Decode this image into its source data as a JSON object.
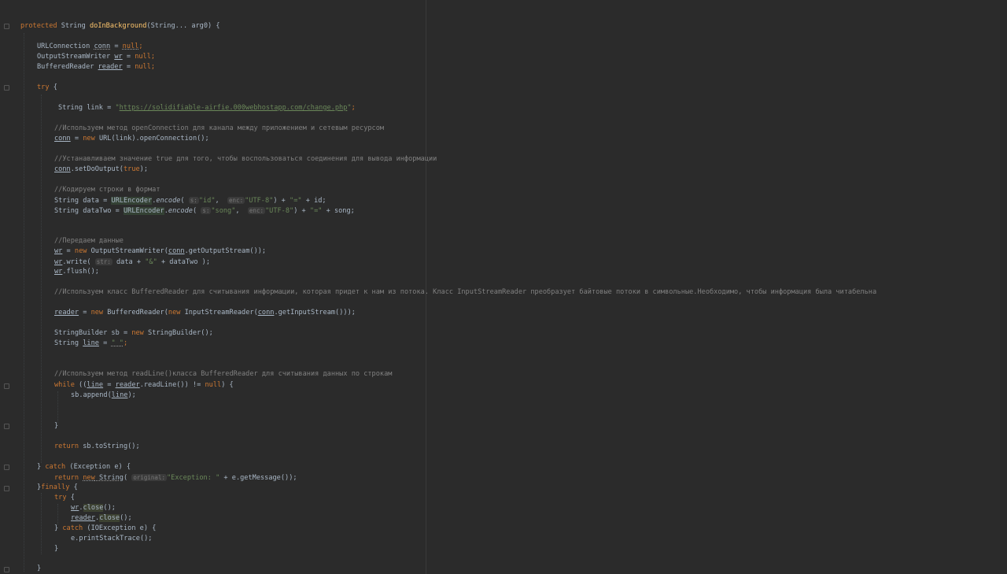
{
  "editor": {
    "lines": {
      "method_sig": {
        "kw_protected": "protected",
        "type": " String ",
        "method_name": "doInBackground",
        "params": "(String... arg0) {"
      },
      "decl_conn": {
        "type": "URLConnection ",
        "var": "conn",
        "eq": " = ",
        "val": "null",
        "semi": ";"
      },
      "decl_wr": {
        "type": "OutputStreamWriter ",
        "var": "wr",
        "eq": " = ",
        "val": "null",
        "semi": ";"
      },
      "decl_reader": {
        "type": "BufferedReader ",
        "var": "reader",
        "eq": " = ",
        "val": "null",
        "semi": ";"
      },
      "try_open": {
        "kw": "try",
        "brace": " {"
      },
      "link_decl": {
        "prefix": "String link = ",
        "q1": "\"",
        "url": "https://solidifiable-airfie.000webhostapp.com/change.php",
        "q2": "\"",
        "semi": ";"
      },
      "comment_open_connection": "//Используем метод openConnection для канала между приложением и сетевым ресурсом",
      "open_conn": {
        "var": "conn",
        "eq": " = ",
        "kw_new": "new",
        "rest": " URL(link).openConnection();"
      },
      "comment_set_do_output": "//Устанавливаем значение true для того, чтобы воспользоваться соединения для вывода информации",
      "set_do_output": {
        "var": "conn",
        "call": ".setDoOutput(",
        "val": "true",
        "end": ");"
      },
      "comment_encode": "//Кодируем строки в формат",
      "data_decl": {
        "prefix": "String data = ",
        "cls": "URLEncoder",
        "dot": ".",
        "method": "encode",
        "open": "( ",
        "hint1": "s:",
        "arg1": "\"id\"",
        "sep": ",  ",
        "hint2": "enc:",
        "arg2": "\"UTF-8\"",
        "tail1": ") + ",
        "arg3": "\"=\"",
        "tail2": " + id;"
      },
      "data_two_decl": {
        "prefix": "String dataTwo = ",
        "cls": "URLEncoder",
        "dot": ".",
        "method": "encode",
        "open": "( ",
        "hint1": "s:",
        "arg1": "\"song\"",
        "sep": ",  ",
        "hint2": "enc:",
        "arg2": "\"UTF-8\"",
        "tail1": ") + ",
        "arg3": "\"=\"",
        "tail2": " + song;"
      },
      "comment_send": "//Передаем данные",
      "wr_assign": {
        "var": "wr",
        "eq": " = ",
        "kw_new": "new",
        "mid": " OutputStreamWriter(",
        "var2": "conn",
        "end": ".getOutputStream());"
      },
      "wr_write": {
        "var": "wr",
        "call": ".write( ",
        "hint": "str:",
        "args": " data + ",
        "str": "\"&\"",
        "end": " + dataTwo );"
      },
      "wr_flush": {
        "var": "wr",
        "end": ".flush();"
      },
      "comment_buffered_reader": "//Используем класс BufferedReader для считывания информации, которая придет к нам из потока. Класс InputStreamReader преобразует байтовые потоки в символьные.Необходимо, чтобы информация была читабельна",
      "reader_assign": {
        "var": "reader",
        "eq": " = ",
        "kw_new1": "new",
        "mid1": " BufferedReader(",
        "kw_new2": "new",
        "mid2": " InputStreamReader(",
        "var2": "conn",
        "end": ".getInputStream()));"
      },
      "sb_decl": {
        "prefix": "StringBuilder sb = ",
        "kw_new": "new",
        "end": " StringBuilder();"
      },
      "line_decl": {
        "prefix": "String ",
        "var": "line",
        "eq": " = ",
        "val": "\" \"",
        "semi": ";"
      },
      "comment_readline": "//Используем метод readLine()класса BufferedReader для считывания данных по строкам",
      "while_line": {
        "kw": "while",
        "p1": " ((",
        "var1": "line",
        "p2": " = ",
        "var2": "reader",
        "p3": ".readLine()) != ",
        "kw_null": "null",
        "p4": ") {"
      },
      "sb_append": {
        "prefix": "sb.append(",
        "var": "line",
        "end": ");"
      },
      "close_brace_while": "}",
      "return_sb": {
        "kw": "return",
        "rest": " sb.toString();"
      },
      "catch_line": {
        "b": "} ",
        "kw": "catch",
        "rest": " (Exception e) {"
      },
      "return_exception": {
        "kw": "return",
        "sp": " ",
        "kw_new": "new",
        "ctor": " String",
        "open": "( ",
        "hint": "original:",
        "str": "\"Exception: \"",
        "rest": " + e.getMessage());"
      },
      "finally_line": {
        "b": "}",
        "kw": "finally",
        "rest": " {"
      },
      "inner_try": {
        "kw": "try",
        "rest": " {"
      },
      "wr_close": {
        "var": "wr",
        "dot": ".",
        "method": "close",
        "end": "();"
      },
      "reader_close": {
        "var": "reader",
        "dot": ".",
        "method": "close",
        "end": "();"
      },
      "inner_catch": {
        "b": "} ",
        "kw": "catch",
        "rest": " (IOException e) {"
      },
      "print_stack": "e.printStackTrace();",
      "close_inner_catch": "}",
      "close_finally": "}"
    }
  }
}
